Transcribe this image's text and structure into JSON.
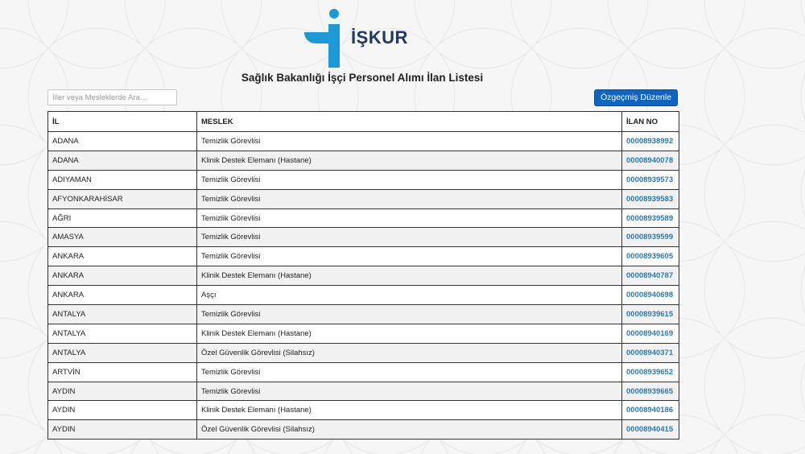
{
  "logo": {
    "text": "İŞKUR"
  },
  "page_title": "Sağlık Bakanlığı İşçi Personel Alımı İlan Listesi",
  "search": {
    "placeholder": "İller veya Mesleklerde Ara..."
  },
  "cv_button_label": "Özgeçmiş Düzenle",
  "colors": {
    "brand_blue": "#1d9ad6",
    "button_blue": "#0e64c1",
    "link_blue": "#2a7ab8"
  },
  "table": {
    "headers": {
      "il": "İL",
      "meslek": "MESLEK",
      "ilan_no": "İLAN NO"
    },
    "rows": [
      {
        "il": "ADANA",
        "meslek": "Temizlik Görevlisi",
        "ilan_no": "00008938992"
      },
      {
        "il": "ADANA",
        "meslek": "Klinik Destek Elemanı (Hastane)",
        "ilan_no": "00008940078"
      },
      {
        "il": "ADIYAMAN",
        "meslek": "Temizlik Görevlisi",
        "ilan_no": "00008939573"
      },
      {
        "il": "AFYONKARAHİSAR",
        "meslek": "Temizlik Görevlisi",
        "ilan_no": "00008939583"
      },
      {
        "il": "AĞRI",
        "meslek": "Temizlik Görevlisi",
        "ilan_no": "00008939589"
      },
      {
        "il": "AMASYA",
        "meslek": "Temizlik Görevlisi",
        "ilan_no": "00008939599"
      },
      {
        "il": "ANKARA",
        "meslek": "Temizlik Görevlisi",
        "ilan_no": "00008939605"
      },
      {
        "il": "ANKARA",
        "meslek": "Klinik Destek Elemanı (Hastane)",
        "ilan_no": "00008940787"
      },
      {
        "il": "ANKARA",
        "meslek": "Aşçı",
        "ilan_no": "00008940698"
      },
      {
        "il": "ANTALYA",
        "meslek": "Temizlik Görevlisi",
        "ilan_no": "00008939615"
      },
      {
        "il": "ANTALYA",
        "meslek": "Klinik Destek Elemanı (Hastane)",
        "ilan_no": "00008940169"
      },
      {
        "il": "ANTALYA",
        "meslek": "Özel Güvenlik Görevlisi (Silahsız)",
        "ilan_no": "00008940371"
      },
      {
        "il": "ARTVİN",
        "meslek": "Temizlik Görevlisi",
        "ilan_no": "00008939652"
      },
      {
        "il": "AYDIN",
        "meslek": "Temizlik Görevlisi",
        "ilan_no": "00008939665"
      },
      {
        "il": "AYDIN",
        "meslek": "Klinik Destek Elemanı (Hastane)",
        "ilan_no": "00008940186"
      },
      {
        "il": "AYDIN",
        "meslek": "Özel Güvenlik Görevlisi (Silahsız)",
        "ilan_no": "00008940415"
      }
    ]
  }
}
